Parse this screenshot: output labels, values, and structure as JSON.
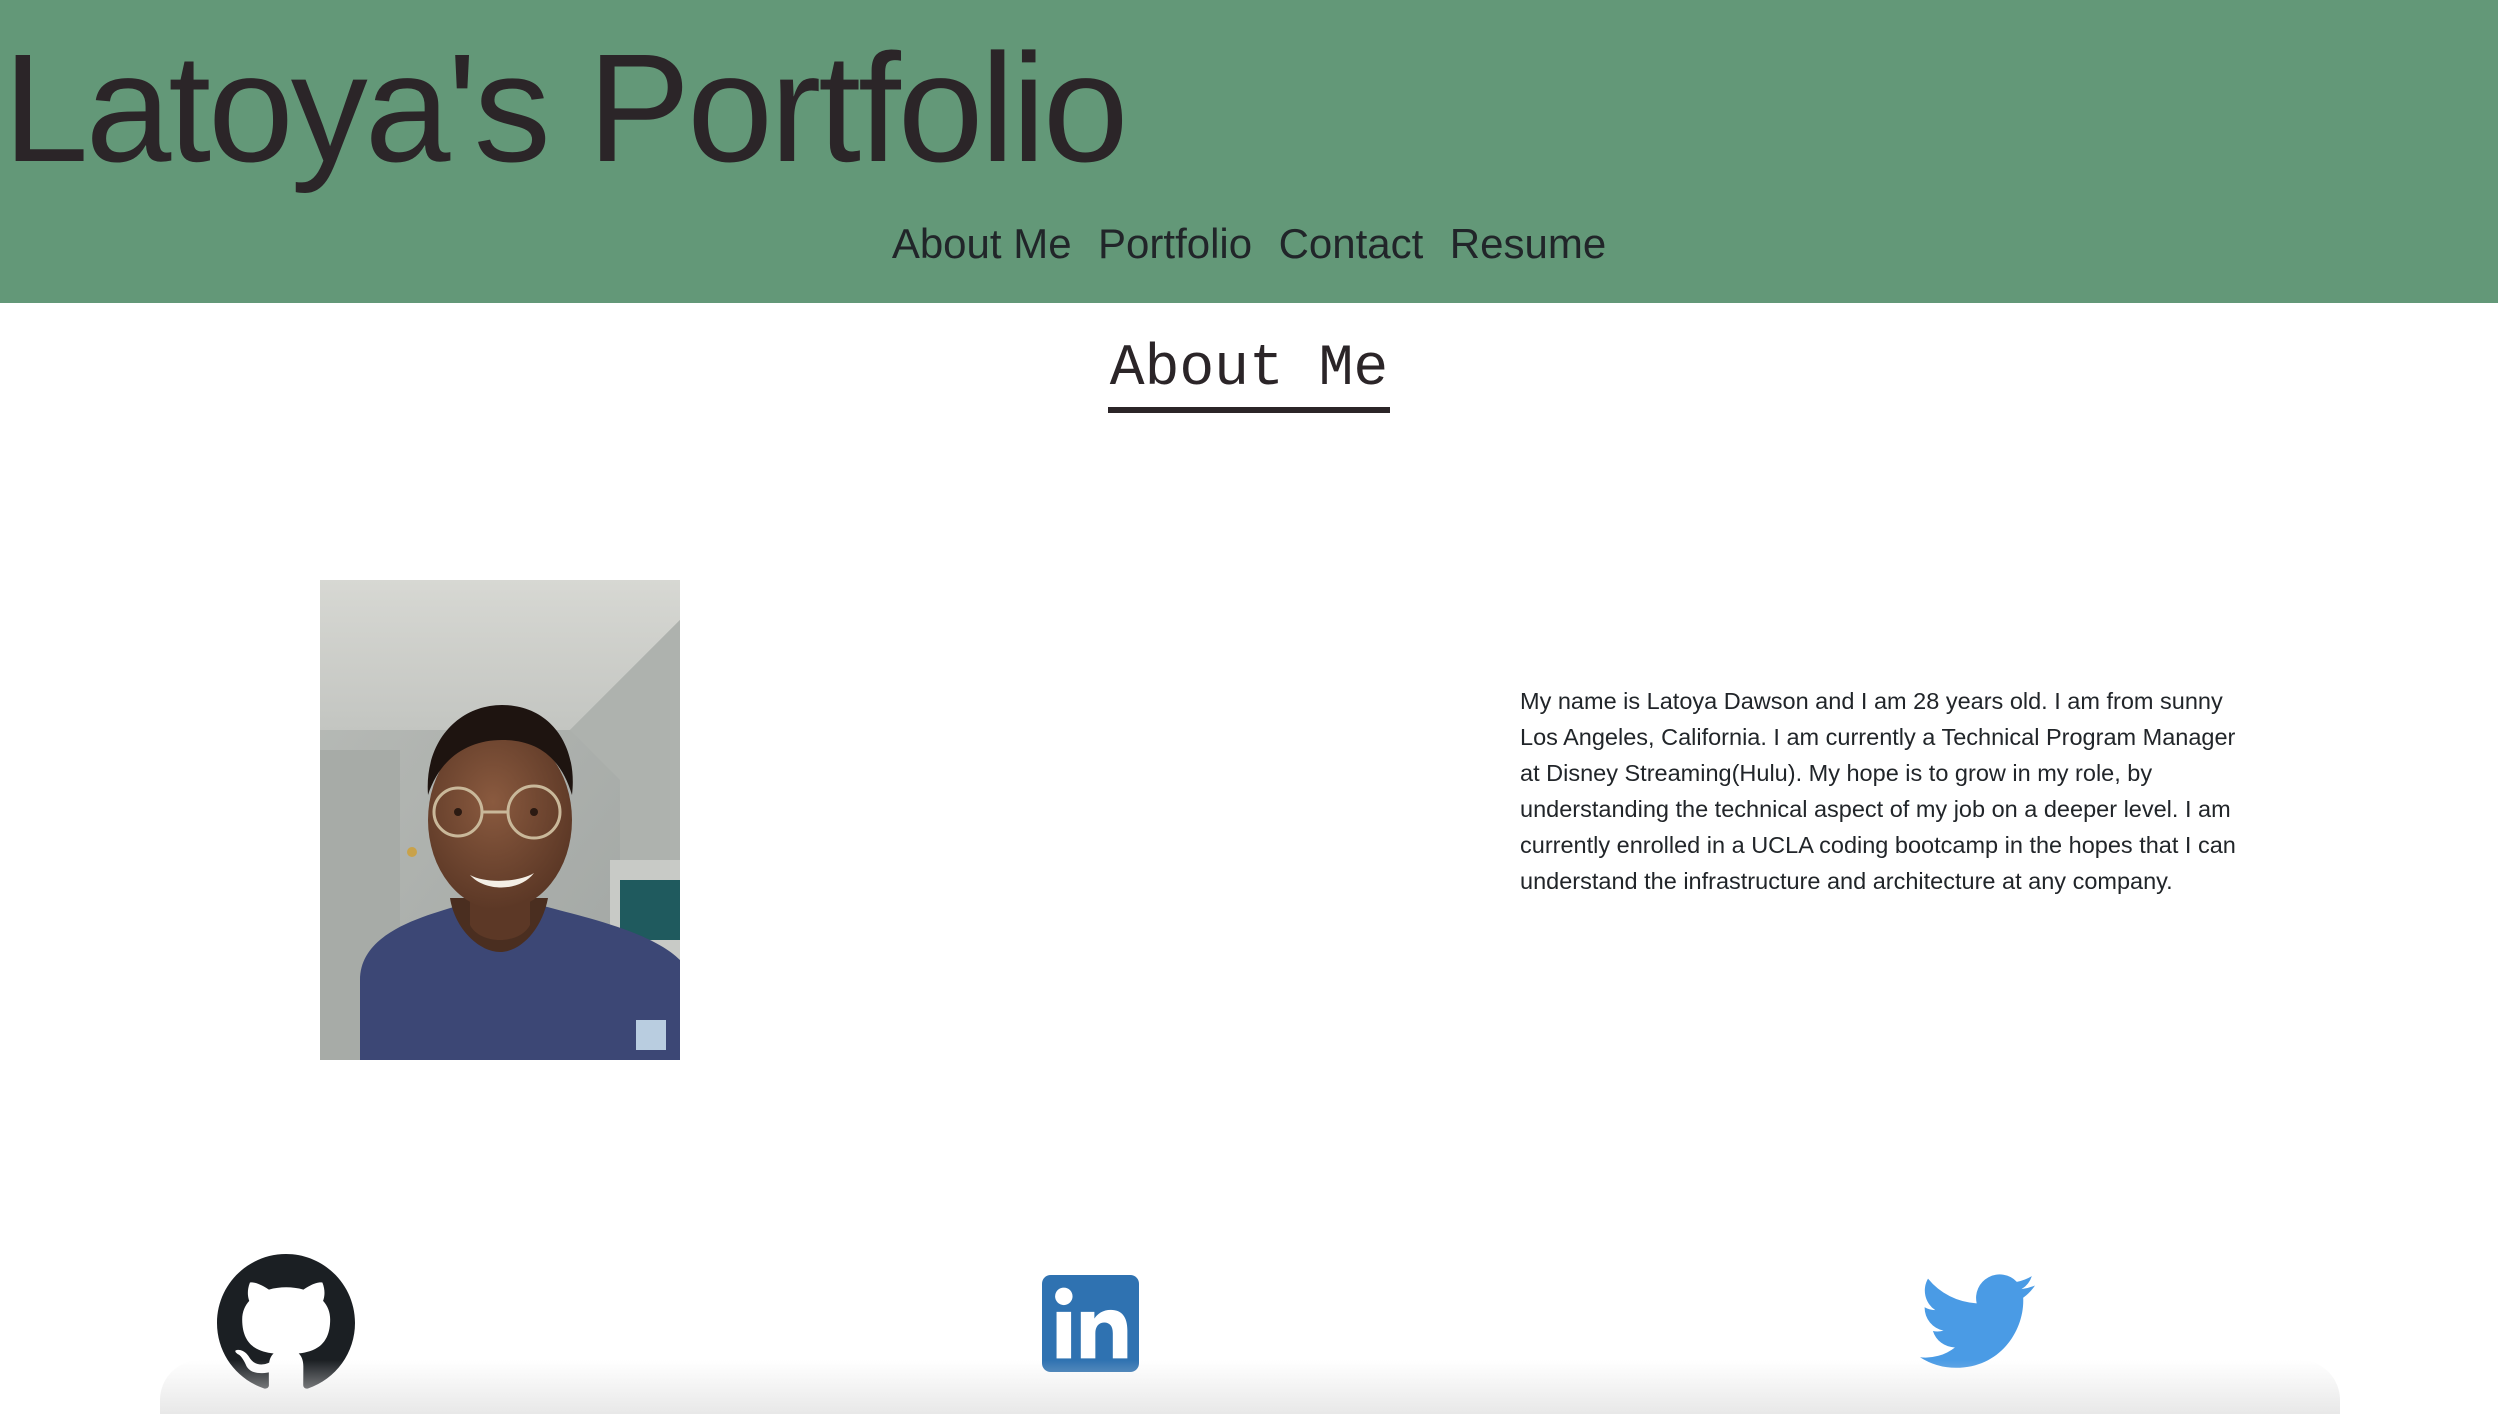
{
  "header": {
    "title": "Latoya's Portfolio",
    "background_color": "#639878",
    "nav": [
      {
        "label": "About Me"
      },
      {
        "label": "Portfolio"
      },
      {
        "label": "Contact"
      },
      {
        "label": "Resume"
      }
    ]
  },
  "about": {
    "heading": "About Me",
    "photo_icon": "profile-photo",
    "bio": "My name is Latoya Dawson and I am 28 years old. I am from sunny Los Angeles, California. I am currently a Technical Program Manager at Disney Streaming(Hulu). My hope is to grow in my role, by understanding the technical aspect of my job on a deeper level. I am currently enrolled in a UCLA coding bootcamp in the hopes that I can understand the infrastructure and architecture at any company."
  },
  "social": [
    {
      "icon": "github-icon",
      "color": "#1b1f23"
    },
    {
      "icon": "linkedin-icon",
      "color": "#2f72b1"
    },
    {
      "icon": "twitter-icon",
      "color": "#4a9be5"
    }
  ]
}
